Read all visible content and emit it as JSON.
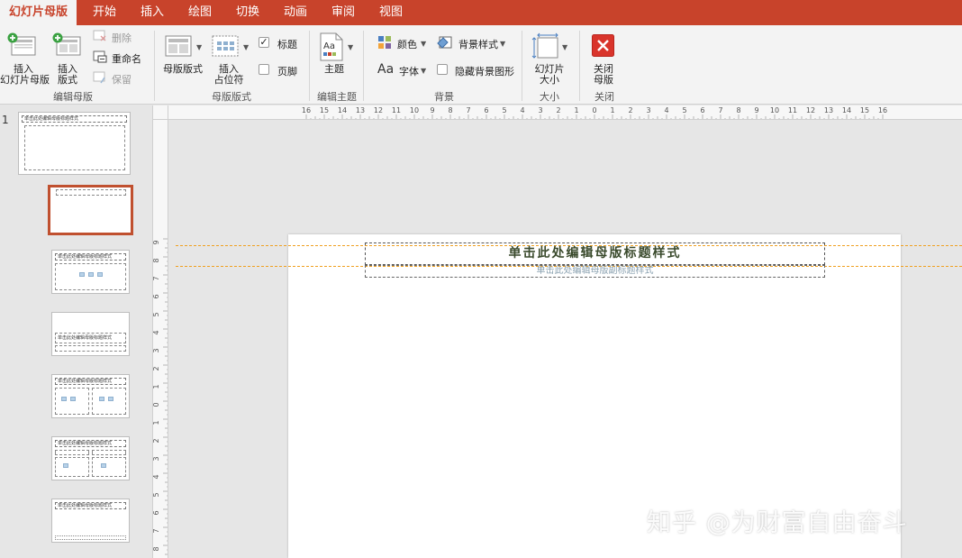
{
  "tabs": [
    "幻灯片母版",
    "开始",
    "插入",
    "绘图",
    "切换",
    "动画",
    "审阅",
    "视图"
  ],
  "ribbon": {
    "edit_master": {
      "insert_slide_master": [
        "插入",
        "幻灯片母版"
      ],
      "insert_layout": [
        "插入",
        "版式"
      ],
      "delete": "删除",
      "rename": "重命名",
      "preserve": "保留",
      "group_label": "编辑母版"
    },
    "master_layout": {
      "master_layout": "母版版式",
      "insert_placeholder": [
        "插入",
        "占位符"
      ],
      "title": "标题",
      "title_checked": true,
      "footers": "页脚",
      "footers_checked": false,
      "group_label": "母版版式"
    },
    "edit_theme": {
      "theme": "主题",
      "group_label": "编辑主题"
    },
    "background": {
      "colors": "颜色",
      "fonts": "字体",
      "background_styles": "背景样式",
      "hide_bg_graphics": "隐藏背景图形",
      "hide_checked": false,
      "group_label": "背景"
    },
    "size": {
      "slide_size": [
        "幻灯片",
        "大小"
      ],
      "group_label": "大小"
    },
    "close": {
      "close_master": [
        "关闭",
        "母版"
      ],
      "group_label": "关闭"
    }
  },
  "thumbnails": {
    "master_number": "1",
    "master_title": "单击此处编辑母版标题样式",
    "layout_title": "单击此处编辑母版标题样式",
    "section_title": "单击此处编辑母版标题样式"
  },
  "ruler": {
    "h_labels": [
      "16",
      "15",
      "14",
      "13",
      "12",
      "11",
      "10",
      "9",
      "8",
      "7",
      "6",
      "5",
      "4",
      "3",
      "2",
      "1",
      "0",
      "1",
      "2",
      "3",
      "4",
      "5",
      "6",
      "7",
      "8",
      "9",
      "10",
      "11",
      "12",
      "13",
      "14",
      "15",
      "16"
    ],
    "v_labels": [
      "9",
      "8",
      "7",
      "6",
      "5",
      "4",
      "3",
      "2",
      "1",
      "0",
      "1",
      "2",
      "3",
      "4",
      "5",
      "6",
      "7",
      "8"
    ]
  },
  "slide": {
    "title_placeholder": "单击此处编辑母版标题样式",
    "subtitle_placeholder": "单击此处编辑母版副标题样式"
  },
  "watermark": "知乎 @为财富自由奋斗",
  "colors": {
    "accent": "#c8432b",
    "selection": "#c0502f",
    "guide": "#f0a020"
  }
}
